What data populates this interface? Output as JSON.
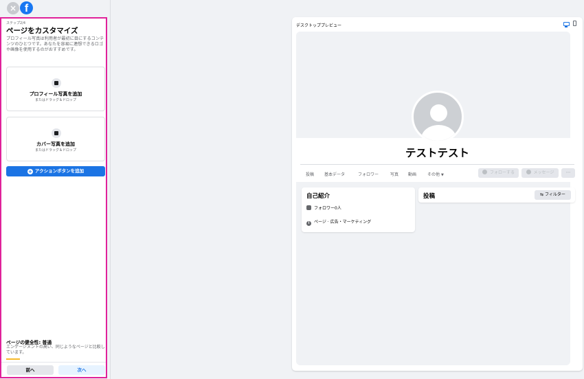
{
  "window": {
    "close_icon": "×",
    "logo_letter": "f"
  },
  "left_panel": {
    "step": "ステップ2/4",
    "title": "ページをカスタマイズ",
    "description": "プロフィール写真は利用者が最初に目にするコンテンツのひとつです。あなたを容易に連想できるロゴや画像を使用するのがおすすめです。",
    "profile_upload": {
      "title": "プロフィール写真を追加",
      "sub": "またはドラッグ＆ドロップ"
    },
    "cover_upload": {
      "title": "カバー写真を追加",
      "sub": "またはドラッグ＆ドロップ"
    },
    "action_button": "アクションボタンを追加",
    "health_title": "ページの健全性: 普通",
    "health_desc": "エンゲージメントの高い、同じようなページと比較しています。",
    "prev_button": "前へ",
    "next_button": "次へ"
  },
  "preview": {
    "title": "デスクトッププレビュー",
    "page_name": "テストテスト",
    "tabs": [
      "投稿",
      "基本データ",
      "フォロワー",
      "写真",
      "動画",
      "その他"
    ],
    "caret": "▼",
    "follow_button": "フォローする",
    "message_button": "メッセージ",
    "more_button": "···",
    "intro_title": "自己紹介",
    "followers": "フォロワー0人",
    "category": "ページ · 広告・マーケティング",
    "posts_title": "投稿",
    "filter_button": "フィルター",
    "filter_icon": "⇆"
  },
  "colors": {
    "brand": "#1877f2",
    "highlight_border": "#e0219a",
    "health_bar": "#f7b928"
  }
}
